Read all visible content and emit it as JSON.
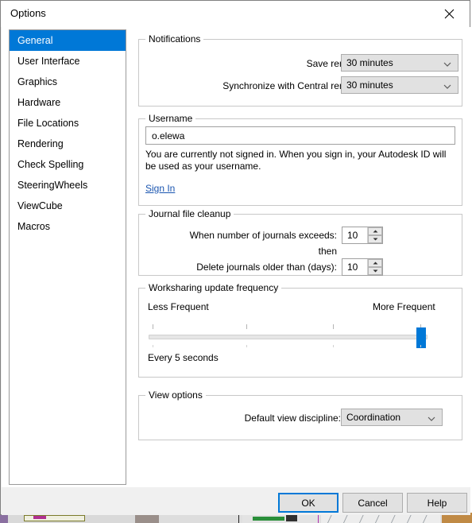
{
  "window": {
    "title": "Options",
    "close_icon": "close-icon"
  },
  "sidebar": {
    "items": [
      {
        "label": "General",
        "selected": true
      },
      {
        "label": "User Interface",
        "selected": false
      },
      {
        "label": "Graphics",
        "selected": false
      },
      {
        "label": "Hardware",
        "selected": false
      },
      {
        "label": "File Locations",
        "selected": false
      },
      {
        "label": "Rendering",
        "selected": false
      },
      {
        "label": "Check Spelling",
        "selected": false
      },
      {
        "label": "SteeringWheels",
        "selected": false
      },
      {
        "label": "ViewCube",
        "selected": false
      },
      {
        "label": "Macros",
        "selected": false
      }
    ]
  },
  "notifications": {
    "legend": "Notifications",
    "save_reminder_label": "Save reminder interval:",
    "save_reminder_value": "30 minutes",
    "sync_reminder_label": "Synchronize with Central reminder interval:",
    "sync_reminder_value": "30 minutes",
    "dropdown_icon": "chevron-down-icon"
  },
  "username": {
    "legend": "Username",
    "value": "o.elewa",
    "placeholder": "",
    "help_text": "You are currently not signed in. When you sign in, your Autodesk ID will be used as your username.",
    "sign_in_link": "Sign In"
  },
  "journal": {
    "legend": "Journal file cleanup",
    "exceeds_label": "When number of journals exceeds:",
    "exceeds_value": "10",
    "then_label": "then",
    "delete_label": "Delete journals older than (days):",
    "delete_value": "10",
    "spin_up_icon": "spin-up-arrow-icon",
    "spin_down_icon": "spin-down-arrow-icon"
  },
  "worksharing": {
    "legend": "Worksharing update frequency",
    "less_label": "Less Frequent",
    "more_label": "More Frequent",
    "status_label": "Every 5 seconds",
    "slider_percent": 100,
    "slider_min": 0,
    "slider_max": 100
  },
  "view_options": {
    "legend": "View options",
    "discipline_label": "Default view discipline:",
    "discipline_value": "Coordination",
    "dropdown_icon": "chevron-down-icon"
  },
  "footer": {
    "ok_label": "OK",
    "cancel_label": "Cancel",
    "help_label": "Help"
  },
  "colors": {
    "accent": "#0078d7",
    "link": "#1a55b0",
    "dialog_bg": "#f0f0f0",
    "control_bg": "#e1e1e1",
    "group_border": "#c8c8c8"
  }
}
